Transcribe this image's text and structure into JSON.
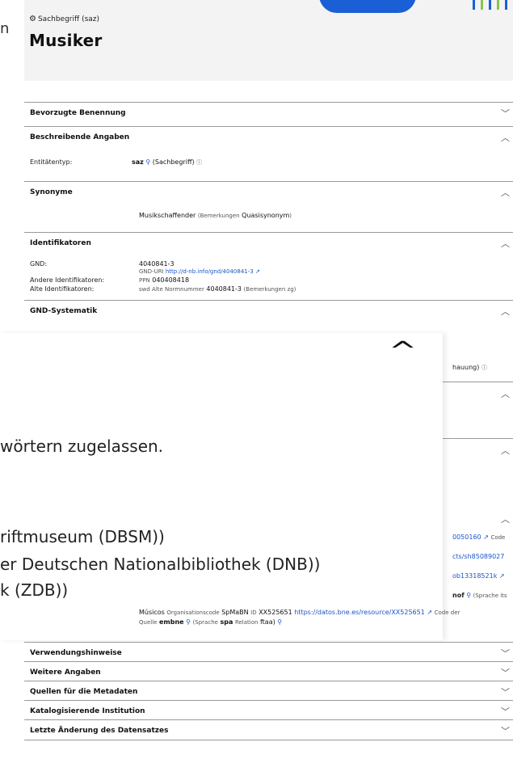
{
  "header": {
    "left_fragment": "n",
    "type_icon": "gear-icon",
    "type_label": "Sachbegriff (saz)",
    "title": "Musiker"
  },
  "sections": {
    "preferred": {
      "title": "Bevorzugte Benennung",
      "state": "collapsed"
    },
    "descriptive": {
      "title": "Beschreibende Angaben",
      "state": "expanded",
      "entity_label": "Entitätentyp:",
      "entity_value": "saz",
      "entity_paren": "(Sachbegriff)",
      "info_icon": "info-icon"
    },
    "synonyms": {
      "title": "Synonyme",
      "value": "Musikschaffender",
      "remark_prefix": "(Bemerkungen",
      "remark_bold": "Quasisynonym",
      "remark_suffix": ")"
    },
    "identifiers": {
      "title": "Identifikatoren",
      "gnd_label": "GND:",
      "gnd_value": "4040841-3",
      "gnd_uri_label": "GND-URI",
      "gnd_uri": "http://d-nb.info/gnd/4040841-3",
      "other_label": "Andere Identifikatoren:",
      "other_prefix": "PPN",
      "other_value": "040408418",
      "old_label": "Alte Identifikatoren:",
      "old_prefix": "swd Alte Normnummer",
      "old_value": "4040841-3",
      "old_remark": "(Bemerkungen zg)"
    },
    "gnd_system": {
      "title": "GND-Systematik"
    }
  },
  "overlay": {
    "line1": "wörtern zugelassen.",
    "line2": "riftmuseum (DBSM))",
    "line3": "er Deutschen Nationalbibliothek (DNB))",
    "line4": "k (ZDB))"
  },
  "right_fragments": {
    "r1": "hauung)",
    "r2": "0050160",
    "r2_tail": "Code",
    "r3": "cts/sh85089027",
    "r4": "ob13318521k",
    "r5_bold": "nof",
    "r5_tail": "(Sprache its"
  },
  "musicos": {
    "name": "Músicos",
    "org_label": "Organisationscode",
    "org_value": "SpMaBN",
    "id_label": "ID",
    "id_value": "XX525651",
    "url": "https://datos.bne.es/resource/XX525651",
    "tail": "Code der",
    "quelle_label": "Quelle",
    "quelle_value": "embne",
    "sprache_label": "(Sprache",
    "sprache_value": "spa",
    "relation_label": "Relation",
    "relation_value": "ftaa)"
  },
  "bottom_sections": [
    "Verwendungshinweise",
    "Weitere Angaben",
    "Quellen für die Metadaten",
    "Katalogisierende Institution",
    "Letzte Änderung des Datensatzes"
  ],
  "colors": {
    "link": "#1a55c8",
    "accent_blue": "#1a5fd6"
  }
}
